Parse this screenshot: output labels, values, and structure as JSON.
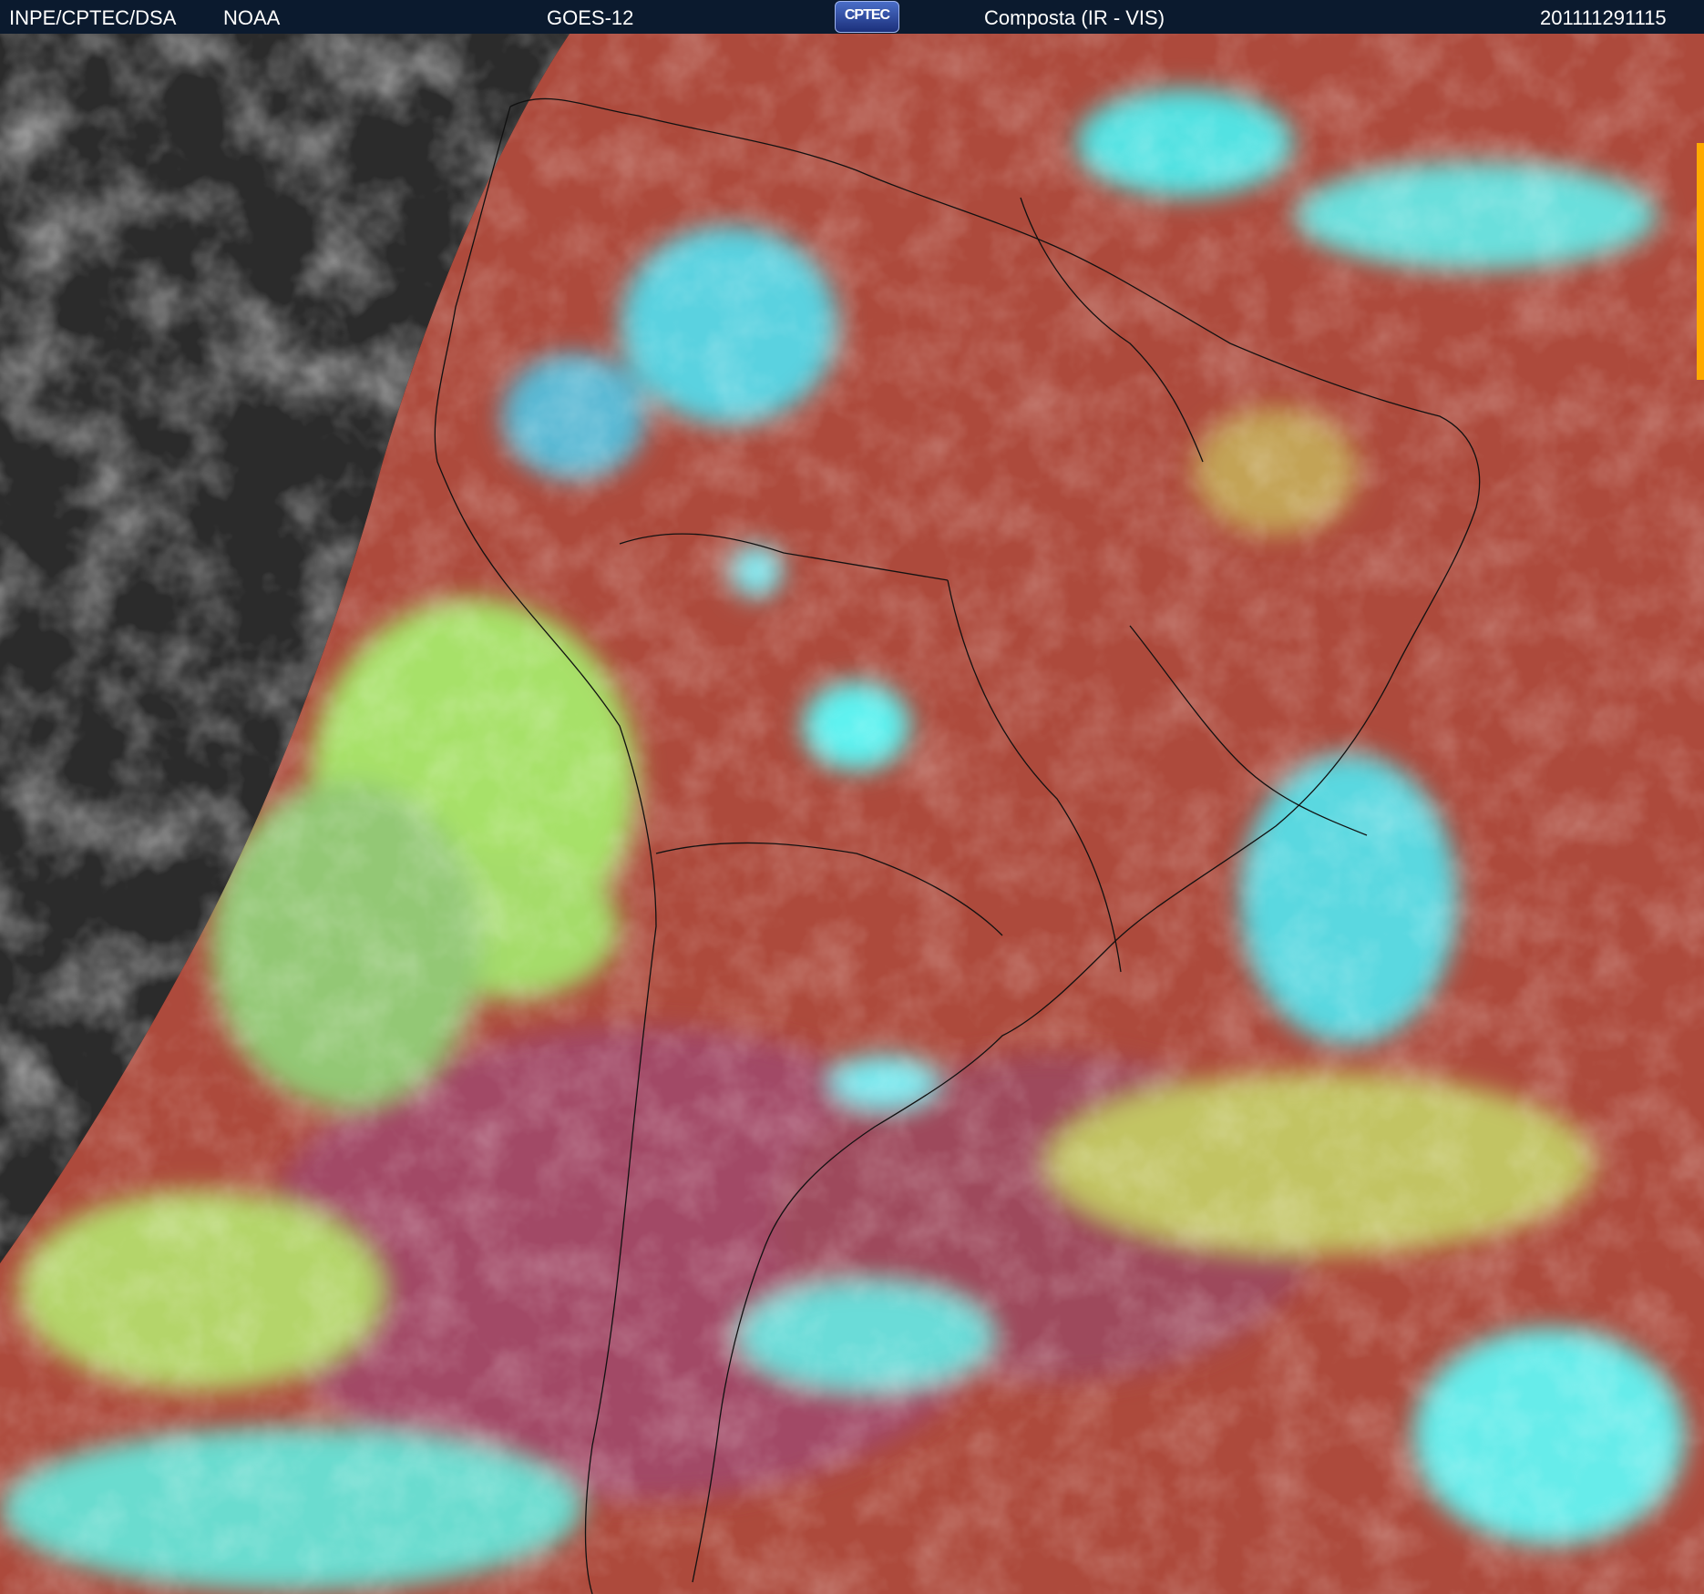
{
  "header": {
    "agency": "INPE/CPTEC/DSA",
    "provider": "NOAA",
    "satellite": "GOES-12",
    "logo_text": "CPTEC",
    "product": "Composta (IR - VIS)",
    "timestamp": "201111291115"
  },
  "imagery": {
    "description_colors": {
      "night_side": "#2a2a2a",
      "land_clear": "#b24a3a",
      "ocean_clear": "#a4453f",
      "low_cloud": "#a6e06a",
      "high_cloud": "#4ee8e6",
      "boundary_lines": "#111111",
      "limb_edge": "#ffaa00"
    }
  }
}
